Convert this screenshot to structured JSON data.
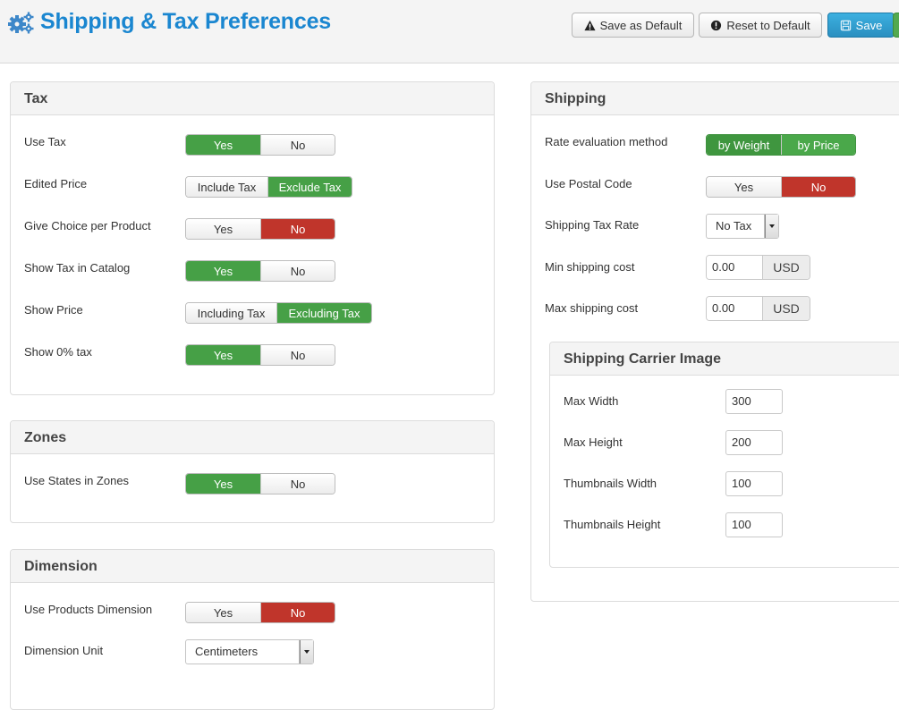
{
  "header": {
    "title": "Shipping & Tax Preferences",
    "title_icon": "gears-icon",
    "accent_color": "#1a86d0",
    "buttons": {
      "save_default": {
        "label": "Save as Default",
        "icon": "warning-icon"
      },
      "reset_default": {
        "label": "Reset to Default",
        "icon": "exclamation-circle-icon"
      },
      "save": {
        "label": "Save",
        "icon": "floppy-disk-icon"
      }
    }
  },
  "tax": {
    "title": "Tax",
    "rows": [
      {
        "label": "Use Tax",
        "options": [
          "Yes",
          "No"
        ],
        "selected": "Yes"
      },
      {
        "label": "Edited Price",
        "options": [
          "Include Tax",
          "Exclude Tax"
        ],
        "selected": "Exclude Tax"
      },
      {
        "label": "Give Choice per Product",
        "options": [
          "Yes",
          "No"
        ],
        "selected": "No"
      },
      {
        "label": "Show Tax in Catalog",
        "options": [
          "Yes",
          "No"
        ],
        "selected": "Yes"
      },
      {
        "label": "Show Price",
        "options": [
          "Including Tax",
          "Excluding Tax"
        ],
        "selected": "Excluding Tax"
      },
      {
        "label": "Show 0% tax",
        "options": [
          "Yes",
          "No"
        ],
        "selected": "Yes"
      }
    ]
  },
  "zones": {
    "title": "Zones",
    "rows": [
      {
        "label": "Use States in Zones",
        "options": [
          "Yes",
          "No"
        ],
        "selected": "Yes"
      }
    ]
  },
  "dimension": {
    "title": "Dimension",
    "rows": [
      {
        "label": "Use Products Dimension",
        "options": [
          "Yes",
          "No"
        ],
        "selected": "No"
      }
    ],
    "unit": {
      "label": "Dimension Unit",
      "value": "Centimeters"
    }
  },
  "shipping": {
    "title": "Shipping",
    "rate_method": {
      "label": "Rate evaluation method",
      "options": [
        "by Weight",
        "by Price"
      ],
      "selected": "by Weight"
    },
    "postal_code": {
      "label": "Use Postal Code",
      "options": [
        "Yes",
        "No"
      ],
      "selected": "No"
    },
    "tax_rate": {
      "label": "Shipping Tax Rate",
      "value": "No Tax"
    },
    "min_cost": {
      "label": "Min shipping cost",
      "value": "0.00",
      "currency": "USD"
    },
    "max_cost": {
      "label": "Max shipping cost",
      "value": "0.00",
      "currency": "USD"
    }
  },
  "carrier_image": {
    "title": "Shipping Carrier Image",
    "fields": [
      {
        "label": "Max Width",
        "value": "300"
      },
      {
        "label": "Max Height",
        "value": "200"
      },
      {
        "label": "Thumbnails Width",
        "value": "100"
      },
      {
        "label": "Thumbnails Height",
        "value": "100"
      }
    ]
  },
  "colors": {
    "yes_active": "#46a046",
    "no_active": "#c0352b",
    "save_button": "#2a9bd0"
  }
}
